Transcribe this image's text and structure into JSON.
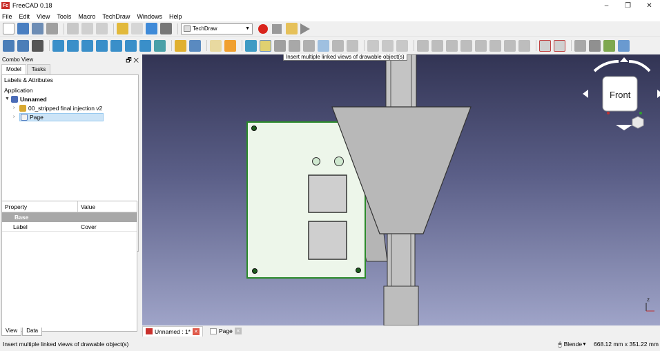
{
  "window": {
    "title": "FreeCAD 0.18",
    "logo_text": "Fc",
    "minimize": "–",
    "maximize": "❐",
    "close": "✕"
  },
  "menu": [
    "File",
    "Edit",
    "View",
    "Tools",
    "Macro",
    "TechDraw",
    "Windows",
    "Help"
  ],
  "toolbar": {
    "workbench": "TechDraw",
    "tooltip": "Insert multiple linked views of drawable object(s)"
  },
  "combo_view": {
    "title": "Combo View",
    "tabs": [
      "Model",
      "Tasks"
    ],
    "tree_header": "Labels & Attributes",
    "tree_root": "Application",
    "tree_items": [
      {
        "label": "Unnamed"
      },
      {
        "label": "00_stripped final injection v2"
      },
      {
        "label": "Page"
      }
    ],
    "property_columns": [
      "Property",
      "Value"
    ],
    "property_group": "Base",
    "properties": [
      {
        "key": "Label",
        "value": "Cover"
      }
    ],
    "bottom_tabs": [
      "View",
      "Data"
    ]
  },
  "navcube": {
    "face": "Front"
  },
  "axis": {
    "label": "z"
  },
  "doc_tabs": [
    {
      "label": "Unnamed : 1*"
    },
    {
      "label": "Page"
    }
  ],
  "status": {
    "message": "Insert multiple linked views of drawable object(s)",
    "nav_style": "Blende",
    "dimensions": "668.12 mm x 351.22 mm"
  },
  "colors": {
    "viewport_top": "#323454",
    "viewport_bottom": "#9fa4c8",
    "plate": "#edf6ea",
    "plate_border": "#2b8a2b",
    "part_grey": "#b8b8b8"
  }
}
